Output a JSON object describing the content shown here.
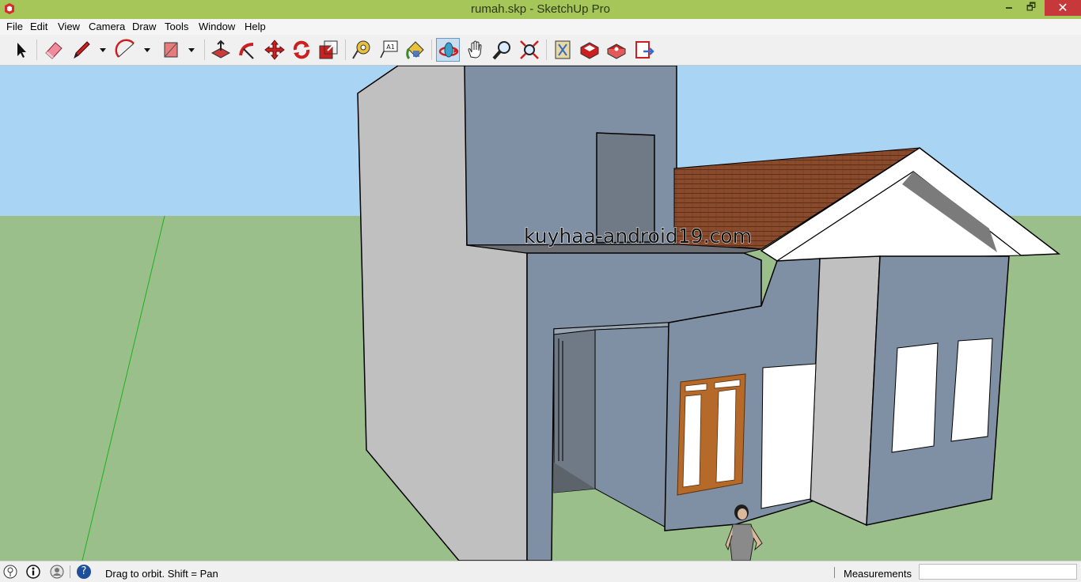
{
  "window": {
    "title": "rumah.skp - SketchUp Pro",
    "minimize_glyph": "🗕",
    "maximize_glyph": "🗗",
    "close_glyph": "✕"
  },
  "menu": {
    "items": [
      "File",
      "Edit",
      "View",
      "Camera",
      "Draw",
      "Tools",
      "Window",
      "Help"
    ]
  },
  "toolbar": {
    "tools": [
      "select-icon",
      "eraser-icon",
      "pencil-icon",
      "arc-icon",
      "rectangle-icon",
      "push-pull-icon",
      "follow-me-icon",
      "move-icon",
      "rotate-icon",
      "scale-icon",
      "tape-measure-icon",
      "text-icon",
      "paint-bucket-icon",
      "orbit-icon",
      "pan-icon",
      "zoom-icon",
      "zoom-extents-icon",
      "3d-warehouse-icon",
      "components-icon",
      "extension-warehouse-icon",
      "send-to-layout-icon"
    ],
    "active_tool": "orbit-icon",
    "text_tool_glyph": "A1"
  },
  "viewport": {
    "watermark": "kuyhaa-android19.com",
    "sky_color": "#a9d4f3",
    "ground_color": "#9bbf8a"
  },
  "statusbar": {
    "message": "Drag to orbit.  Shift = Pan",
    "measurements_label": "Measurements",
    "measurements_value": "",
    "help_glyph": "?"
  },
  "colors": {
    "titlebar": "#a6c65a",
    "close_button": "#c7383a",
    "active_tool_bg": "#c9ddf0"
  }
}
